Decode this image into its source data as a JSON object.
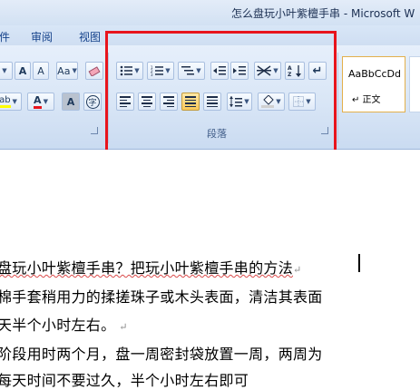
{
  "window": {
    "title": "怎么盘玩小叶紫檀手串 - Microsoft W"
  },
  "tabs": [
    {
      "label": "件"
    },
    {
      "label": "审阅"
    },
    {
      "label": "视图"
    }
  ],
  "ribbon": {
    "font_group": {
      "grow_font": "A",
      "shrink_font": "A",
      "change_case": "Aa",
      "clear_format_icon": "eraser-icon",
      "highlight_label": "ab",
      "font_color_label": "A",
      "char_shading_label": "A",
      "enclose_char_label": "字",
      "highlight_color": "#ffff00",
      "font_color": "#e8141c"
    },
    "paragraph_group": {
      "label": "段落"
    },
    "styles": {
      "sample": "AaBbCcDd",
      "name": "↵ 正文"
    }
  },
  "document": {
    "lines": [
      "盘玩小叶紫檀手串？把玩小叶紫檀手串的方法",
      "棉手套稍用力的揉搓珠子或木头表面，清洁其表面",
      "天半个小时左右。",
      "阶段用时两个月，盘一周密封袋放置一周，两周为",
      "每天时间不要过久，半个小时左右即可"
    ]
  },
  "colors": {
    "highlight_frame": "#e8141c",
    "active_button": "#f9c95a"
  }
}
